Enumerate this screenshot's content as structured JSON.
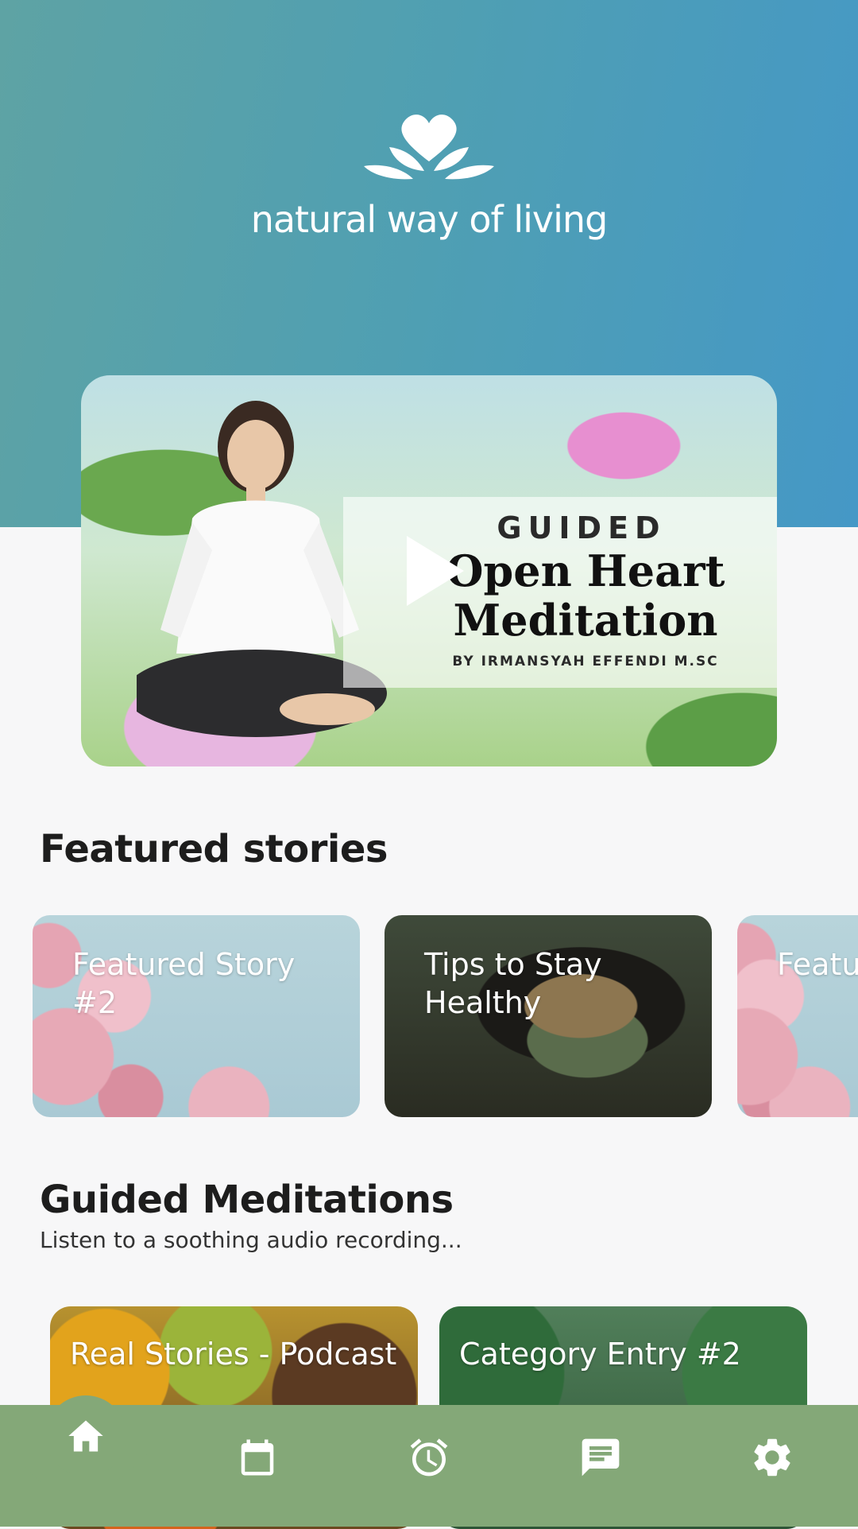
{
  "brand": {
    "name": "natural way of living",
    "header_colors": [
      "#5ea3a4",
      "#4598c6"
    ]
  },
  "hero": {
    "guided": "GUIDED",
    "title_line1": "Open Heart",
    "title_line2": "Meditation",
    "byline": "BY IRMANSYAH EFFENDI M.SC",
    "action_icon": "play-icon"
  },
  "featured": {
    "title": "Featured stories",
    "items": [
      {
        "label": "Featured Story #2"
      },
      {
        "label": "Tips to Stay Healthy"
      },
      {
        "label": "Featu"
      }
    ]
  },
  "guided": {
    "title": "Guided Meditations",
    "subtitle": "Listen to a soothing audio recording...",
    "items": [
      {
        "label": "Real Stories - Podcast"
      },
      {
        "label": "Category Entry #2"
      }
    ]
  },
  "nav": {
    "accent": "#84a878",
    "items": [
      "home-icon",
      "calendar-icon",
      "alarm-icon",
      "chat-icon",
      "settings-icon"
    ]
  }
}
